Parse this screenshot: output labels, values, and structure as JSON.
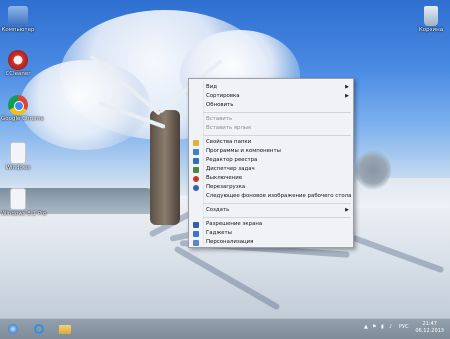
{
  "desktop": {
    "icons": [
      {
        "label": "Компьютер",
        "icon": "computer-icon",
        "color": "#5b8fd8"
      },
      {
        "label": "CCleaner",
        "icon": "ccleaner-icon",
        "color": "#d8342c"
      },
      {
        "label": "Google Chrome",
        "icon": "chrome-icon",
        "color": "#e0b02a"
      },
      {
        "label": "Windows",
        "icon": "file-icon",
        "color": "#f2f4f7"
      },
      {
        "label": "Windows 8.1 Pro",
        "icon": "file-icon",
        "color": "#f2f4f7"
      }
    ],
    "corner_icon": {
      "label": "Корзина",
      "icon": "recycle-bin-icon"
    }
  },
  "context_menu": {
    "items": [
      {
        "label": "Вид",
        "submenu": true,
        "disabled": false,
        "icon": ""
      },
      {
        "label": "Сортировка",
        "submenu": true,
        "disabled": false,
        "icon": ""
      },
      {
        "label": "Обновить",
        "submenu": false,
        "disabled": false,
        "icon": ""
      },
      {
        "label": "Вставить",
        "submenu": false,
        "disabled": true,
        "icon": ""
      },
      {
        "label": "Вставить ярлык",
        "submenu": false,
        "disabled": true,
        "icon": ""
      },
      {
        "label": "Свойства папки",
        "submenu": false,
        "disabled": false,
        "icon": "folder-options-icon"
      },
      {
        "label": "Программы и компоненты",
        "submenu": false,
        "disabled": false,
        "icon": "programs-icon"
      },
      {
        "label": "Редактор реестра",
        "submenu": false,
        "disabled": false,
        "icon": "registry-icon"
      },
      {
        "label": "Диспетчер задач",
        "submenu": false,
        "disabled": false,
        "icon": "task-manager-icon"
      },
      {
        "label": "Выключение",
        "submenu": false,
        "disabled": false,
        "icon": "shutdown-icon"
      },
      {
        "label": "Перезагрузка",
        "submenu": false,
        "disabled": false,
        "icon": "restart-icon"
      },
      {
        "label": "Следующее фоновое изображение рабочего стола",
        "submenu": false,
        "disabled": false,
        "icon": ""
      },
      {
        "label": "Создать",
        "submenu": true,
        "disabled": false,
        "icon": ""
      },
      {
        "label": "Разрешение экрана",
        "submenu": false,
        "disabled": false,
        "icon": "screen-resolution-icon"
      },
      {
        "label": "Гаджеты",
        "submenu": false,
        "disabled": false,
        "icon": "gadgets-icon"
      },
      {
        "label": "Персонализация",
        "submenu": false,
        "disabled": false,
        "icon": "personalization-icon"
      }
    ],
    "icon_colors": {
      "folder-options-icon": "#e2b33a",
      "programs-icon": "#3f7fd0",
      "registry-icon": "#2d6fb8",
      "task-manager-icon": "#4a8a3e",
      "shutdown-icon": "#c8352b",
      "restart-icon": "#2f63b5",
      "screen-resolution-icon": "#2f5faa",
      "gadgets-icon": "#3c76c7",
      "personalization-icon": "#5a86c8"
    }
  },
  "taskbar": {
    "language": "РУС",
    "time": "21:47",
    "date": "06.12.2013",
    "pinned": [
      {
        "icon": "start-button-icon"
      },
      {
        "icon": "internet-explorer-icon"
      },
      {
        "icon": "file-explorer-icon"
      }
    ]
  }
}
